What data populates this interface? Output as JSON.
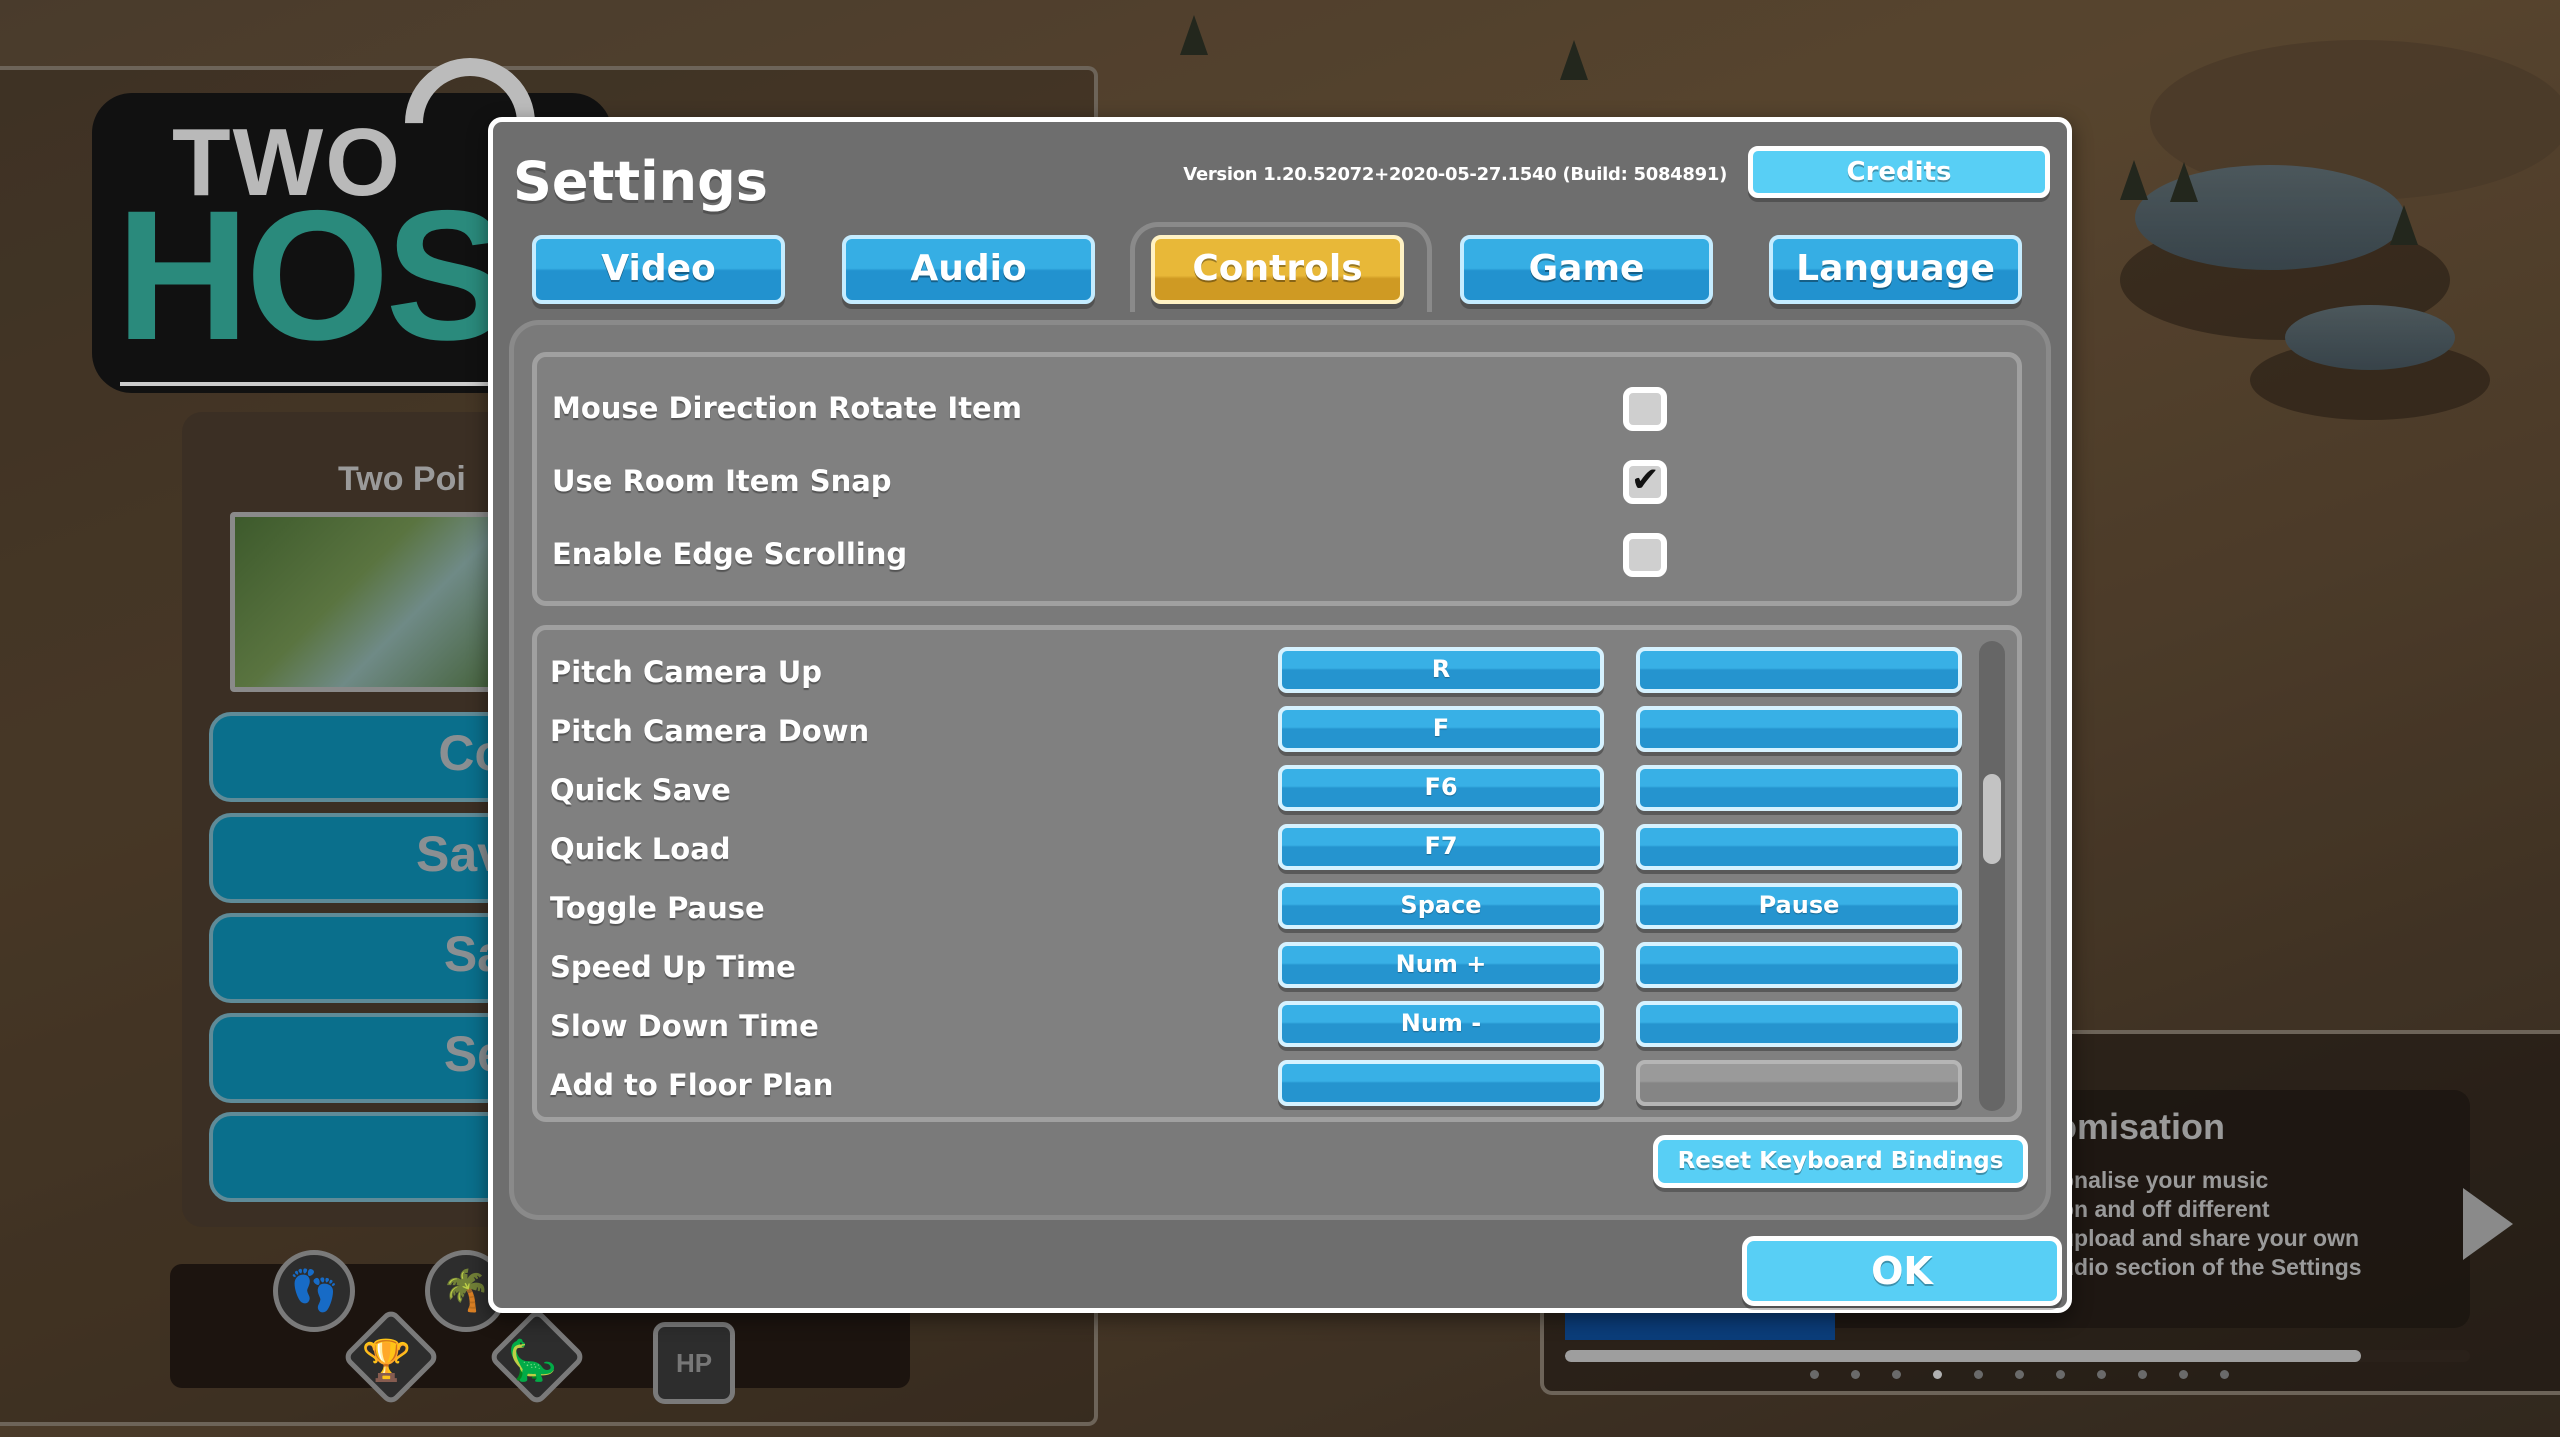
{
  "background": {
    "logo": {
      "line1": "TWO",
      "line2": "HOS"
    },
    "left_menu": {
      "subtitle": "Two Poi",
      "buttons": [
        "Co",
        "Sav",
        "Sa",
        "Se",
        ""
      ]
    },
    "badges": [
      "footprint-icon",
      "palm-tree-icon",
      "trophy-icon",
      "dinosaur-icon",
      "hp-sign-icon"
    ],
    "badge_hp_label": "HP",
    "tips": {
      "title": "omisation",
      "body": "onalise your music\non and off different\nupload and share your own\nudio section of the Settings",
      "progress": 0.88,
      "dot_count": 11,
      "active_dot": 3
    }
  },
  "dialog": {
    "title": "Settings",
    "version": "Version 1.20.52072+2020-05-27.1540 (Build: 5084891)",
    "credits_label": "Credits",
    "tabs": [
      {
        "label": "Video",
        "active": false
      },
      {
        "label": "Audio",
        "active": false
      },
      {
        "label": "Controls",
        "active": true
      },
      {
        "label": "Game",
        "active": false
      },
      {
        "label": "Language",
        "active": false
      }
    ],
    "options": [
      {
        "label": "Mouse Direction Rotate Item",
        "checked": false
      },
      {
        "label": "Use Room Item Snap",
        "checked": true
      },
      {
        "label": "Enable Edge Scrolling",
        "checked": false
      }
    ],
    "checkmark_glyph": "✔",
    "bindings": [
      {
        "action": "Pitch Camera Up",
        "primary": "R",
        "secondary": ""
      },
      {
        "action": "Pitch Camera Down",
        "primary": "F",
        "secondary": ""
      },
      {
        "action": "Quick Save",
        "primary": "F6",
        "secondary": ""
      },
      {
        "action": "Quick Load",
        "primary": "F7",
        "secondary": ""
      },
      {
        "action": "Toggle Pause",
        "primary": "Space",
        "secondary": "Pause"
      },
      {
        "action": "Speed Up Time",
        "primary": "Num +",
        "secondary": ""
      },
      {
        "action": "Slow Down Time",
        "primary": "Num -",
        "secondary": ""
      },
      {
        "action": "Add to Floor Plan",
        "primary": "",
        "secondary": "",
        "secondary_disabled": true
      }
    ],
    "bindings_scroll_position": 0.35,
    "reset_label": "Reset Keyboard Bindings",
    "ok_label": "OK"
  },
  "colors": {
    "tab_blue": "#36aee4",
    "tab_active_yellow": "#e8b838",
    "light_button": "#58cff5",
    "dialog_bg": "#6e6e6e"
  }
}
